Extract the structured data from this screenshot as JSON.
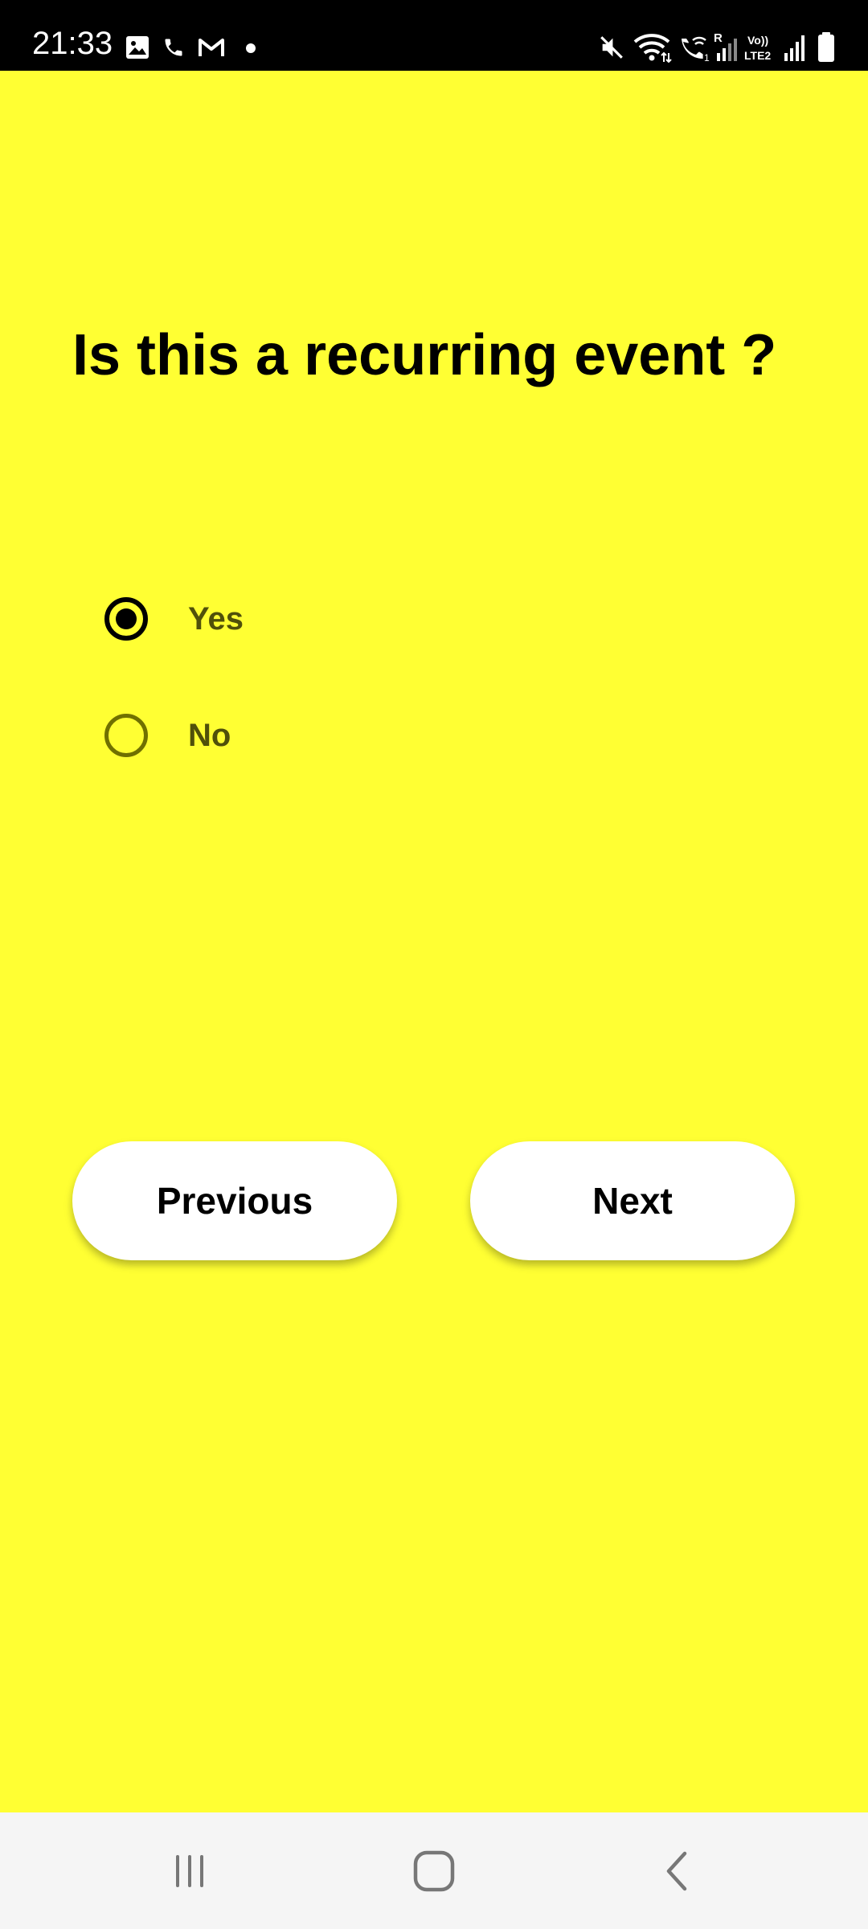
{
  "status_bar": {
    "time": "21:33",
    "left_icons": [
      "image-icon",
      "phone-icon",
      "gmail-icon",
      "notification-dot-icon"
    ],
    "right_icons": [
      "mute-icon",
      "wifi-icon",
      "wifi-calling-icon",
      "signal-r-icon",
      "volte2-icon",
      "signal-icon",
      "battery-icon"
    ],
    "labels": {
      "roaming": "R",
      "volte_top": "Vo))",
      "volte_bottom": "LTE2"
    }
  },
  "question": {
    "text": "Is this a recurring event ?"
  },
  "options": [
    {
      "label": "Yes",
      "selected": true
    },
    {
      "label": "No",
      "selected": false
    }
  ],
  "buttons": {
    "previous": "Previous",
    "next": "Next"
  },
  "nav_bar": {
    "icons": [
      "recent-apps-icon",
      "home-icon",
      "back-icon"
    ]
  },
  "colors": {
    "background": "#ffff33",
    "status_bar": "#000000",
    "nav_bar": "#f5f5f5",
    "button_bg": "#ffffff"
  }
}
